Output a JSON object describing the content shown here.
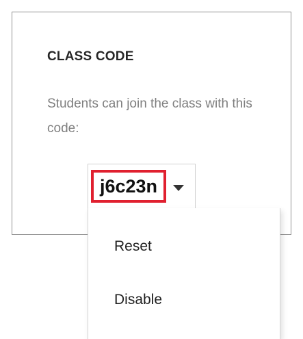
{
  "card": {
    "title": "CLASS CODE",
    "description": "Students can join the class with this code:"
  },
  "code_select": {
    "value": "j6c23n",
    "caret_icon": "caret-down-icon",
    "highlight_color": "#e0202f"
  },
  "menu": {
    "items": [
      {
        "label": "Reset"
      },
      {
        "label": "Disable"
      }
    ]
  }
}
